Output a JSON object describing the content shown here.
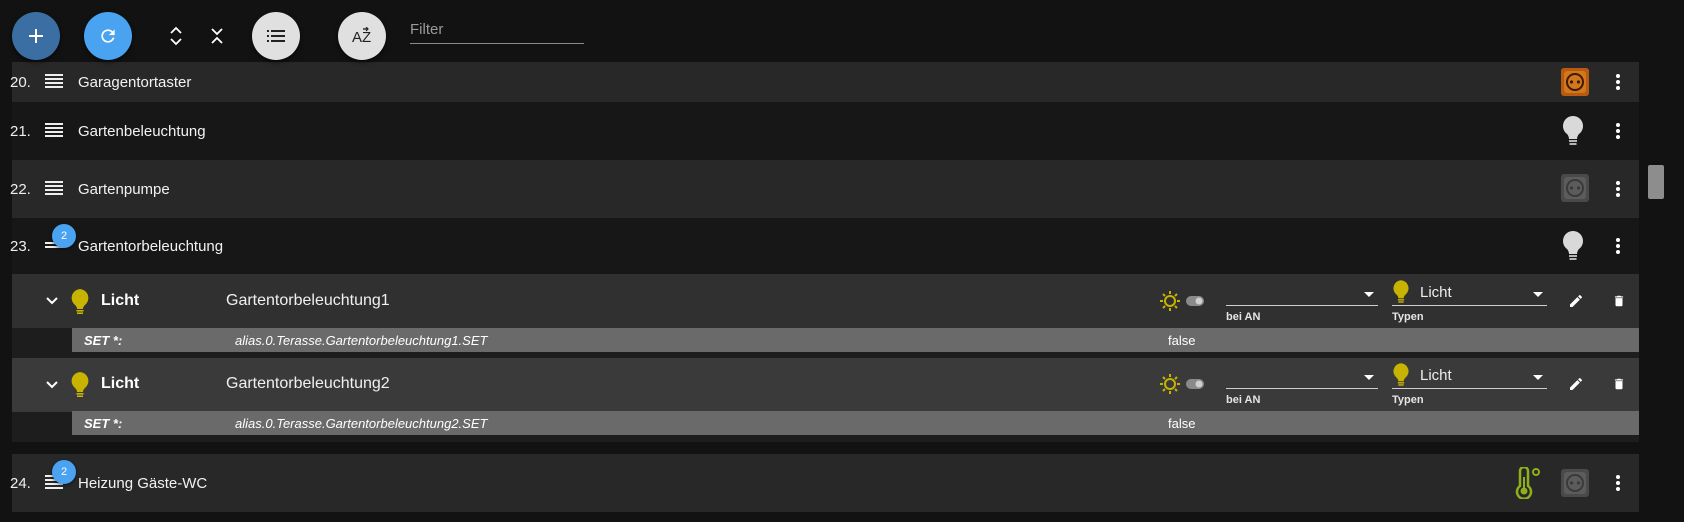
{
  "toolbar": {
    "add_icon": "plus-icon",
    "refresh_icon": "refresh-icon",
    "expand_icon": "expand-all-icon",
    "collapse_icon": "collapse-all-icon",
    "list_icon": "list-icon",
    "sort_icon": "sort-az-icon",
    "sort_label": "AZ",
    "filter_placeholder": "Filter"
  },
  "rows": [
    {
      "num": "20.",
      "name": "Garagentortaster",
      "icon": "socket-icon"
    },
    {
      "num": "21.",
      "name": "Gartenbeleuchtung",
      "icon": "bulb-icon"
    },
    {
      "num": "22.",
      "name": "Gartenpumpe",
      "icon": "socket-icon"
    },
    {
      "num": "23.",
      "name": "Gartentorbeleuchtung",
      "badge": "2",
      "icon": "bulb-icon"
    },
    {
      "num": "24.",
      "name": "Heizung Gäste-WC",
      "badge": "2",
      "icon": "thermometer-icon"
    }
  ],
  "devices": [
    {
      "type": "Licht",
      "name": "Gartentorbeleuchtung1",
      "bei_an_value": "",
      "bei_an_label": "bei AN",
      "typen_value": "Licht",
      "typen_label": "Typen",
      "state_key": "SET *:",
      "state_id": "alias.0.Terasse.Gartentorbeleuchtung1.SET",
      "state_value": "false"
    },
    {
      "type": "Licht",
      "name": "Gartentorbeleuchtung2",
      "bei_an_value": "",
      "bei_an_label": "bei AN",
      "typen_value": "Licht",
      "typen_label": "Typen",
      "state_key": "SET *:",
      "state_id": "alias.0.Terasse.Gartentorbeleuchtung2.SET",
      "state_value": "false"
    }
  ],
  "colors": {
    "accent_blue": "#4aa3f0",
    "fab_add": "#3b6fa4",
    "yellow": "#c8b400",
    "orange_socket": "#d4761c"
  }
}
